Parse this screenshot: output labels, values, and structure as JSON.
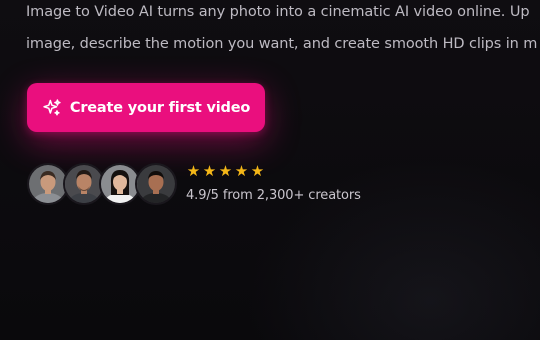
{
  "hero": {
    "description_lines": [
      "Image to Video AI turns any photo into a cinematic AI video online. Up",
      "image, describe the motion you want, and create smooth HD clips in m"
    ],
    "cta_label": "Create your first video",
    "cta_icon": "sparkles-icon",
    "accent_color": "#ea0f7e"
  },
  "social_proof": {
    "avatars": [
      {
        "name": "avatar-1",
        "skin": "#c99a7c",
        "hair": "#3a2b22",
        "shirt": "#8c8f94",
        "bg": "#6d6f72"
      },
      {
        "name": "avatar-2",
        "skin": "#b98466",
        "hair": "#241a15",
        "shirt": "#3c3f45",
        "bg": "#4a4a4e"
      },
      {
        "name": "avatar-3",
        "skin": "#e0b89c",
        "hair": "#15110f",
        "shirt": "#f1f1f1",
        "bg": "#8a8c90"
      },
      {
        "name": "avatar-4",
        "skin": "#a86f52",
        "hair": "#120d0b",
        "shirt": "#232426",
        "bg": "#3a3b3e"
      }
    ],
    "stars": [
      "★",
      "★",
      "★",
      "★",
      "★"
    ],
    "star_color": "#f5b718",
    "rating_text": "4.9/5 from 2,300+ creators"
  }
}
